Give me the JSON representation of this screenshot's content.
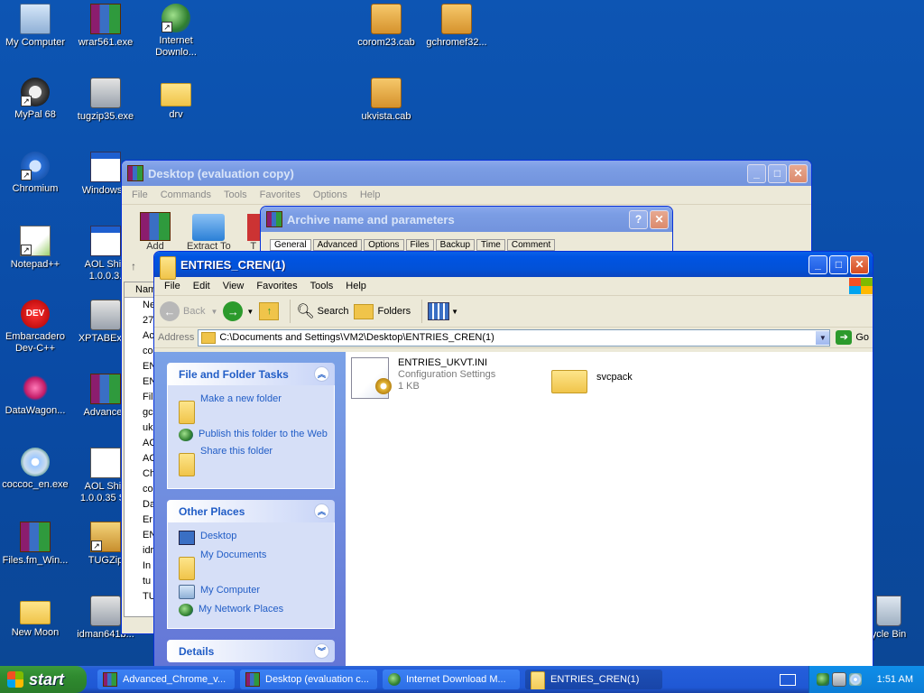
{
  "desktop": {
    "icons": [
      {
        "label": "My Computer"
      },
      {
        "label": "wrar561.exe"
      },
      {
        "label": "Internet Downlo..."
      },
      {
        "label": "corom23.cab"
      },
      {
        "label": "gchromef32..."
      },
      {
        "label": "MyPal 68"
      },
      {
        "label": "tugzip35.exe"
      },
      {
        "label": "drv"
      },
      {
        "label": "ukvista.cab"
      },
      {
        "label": "Chromium"
      },
      {
        "label": "WindowsU"
      },
      {
        "label": "Notepad++"
      },
      {
        "label": "AOL Shie 1.0.0.3."
      },
      {
        "label": "Embarcadero Dev-C++"
      },
      {
        "label": "XPTABExpe"
      },
      {
        "label": "DataWagon..."
      },
      {
        "label": "Advanced"
      },
      {
        "label": "coccoc_en.exe"
      },
      {
        "label": "AOL Shie 1.0.0.35 Se"
      },
      {
        "label": "Files.fm_Win..."
      },
      {
        "label": "TUGZip"
      },
      {
        "label": "New Moon"
      },
      {
        "label": "idman641b..."
      },
      {
        "label": "ycle Bin"
      }
    ]
  },
  "winrar": {
    "title": "Desktop (evaluation copy)",
    "menu": [
      "File",
      "Commands",
      "Tools",
      "Favorites",
      "Options",
      "Help"
    ],
    "toolbar": [
      "Add",
      "Extract To",
      "T"
    ],
    "column": "Name",
    "rows": [
      "Ne",
      "27",
      "Ac",
      "co",
      "EN",
      "EN",
      "Fil",
      "gc",
      "uk",
      "AC",
      "AC",
      "Ch",
      "co",
      "Da",
      "Er",
      "EN",
      "idr",
      "In",
      "tu",
      "TU"
    ]
  },
  "archive_dialog": {
    "title": "Archive name and parameters",
    "tabs": [
      "General",
      "Advanced",
      "Options",
      "Files",
      "Backup",
      "Time",
      "Comment"
    ]
  },
  "explorer": {
    "title": "ENTRIES_CREN(1)",
    "menu": [
      "File",
      "Edit",
      "View",
      "Favorites",
      "Tools",
      "Help"
    ],
    "toolbar": {
      "back": "Back",
      "search": "Search",
      "folders": "Folders"
    },
    "address_label": "Address",
    "address": "C:\\Documents and Settings\\VM2\\Desktop\\ENTRIES_CREN(1)",
    "go": "Go",
    "panels": {
      "tasks": {
        "title": "File and Folder Tasks",
        "items": [
          "Make a new folder",
          "Publish this folder to the Web",
          "Share this folder"
        ]
      },
      "places": {
        "title": "Other Places",
        "items": [
          "Desktop",
          "My Documents",
          "My Computer",
          "My Network Places"
        ]
      },
      "details": {
        "title": "Details"
      }
    },
    "files": [
      {
        "name": "ENTRIES_UKVT.INI",
        "type": "Configuration Settings",
        "size": "1 KB"
      },
      {
        "name": "svcpack"
      }
    ]
  },
  "taskbar": {
    "start": "start",
    "tasks": [
      "Advanced_Chrome_v...",
      "Desktop (evaluation c...",
      "Internet Download M...",
      "ENTRIES_CREN(1)"
    ],
    "clock": "1:51 AM"
  },
  "colors": {
    "title_active": "#0054e3",
    "taskpane": "#6f8ce0",
    "taskbar": "#245edb"
  }
}
